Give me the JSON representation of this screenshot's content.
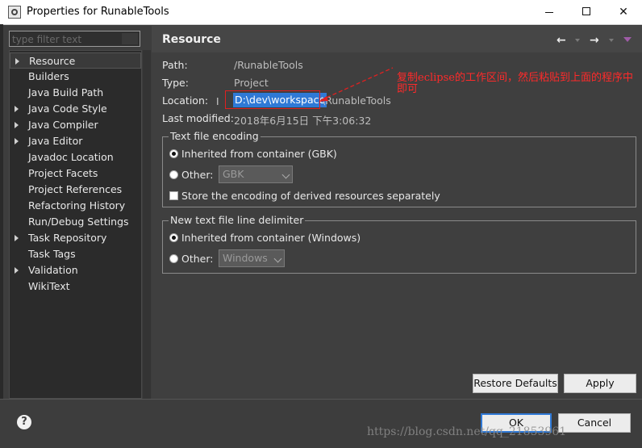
{
  "window": {
    "title": "Properties for RunableTools"
  },
  "filter": {
    "placeholder": "type filter text"
  },
  "tree": {
    "items": [
      {
        "label": "Resource",
        "expandable": true,
        "selected": true
      },
      {
        "label": "Builders",
        "expandable": false
      },
      {
        "label": "Java Build Path",
        "expandable": false
      },
      {
        "label": "Java Code Style",
        "expandable": true
      },
      {
        "label": "Java Compiler",
        "expandable": true
      },
      {
        "label": "Java Editor",
        "expandable": true
      },
      {
        "label": "Javadoc Location",
        "expandable": false
      },
      {
        "label": "Project Facets",
        "expandable": false
      },
      {
        "label": "Project References",
        "expandable": false
      },
      {
        "label": "Refactoring History",
        "expandable": false
      },
      {
        "label": "Run/Debug Settings",
        "expandable": false
      },
      {
        "label": "Task Repository",
        "expandable": true
      },
      {
        "label": "Task Tags",
        "expandable": false
      },
      {
        "label": "Validation",
        "expandable": true
      },
      {
        "label": "WikiText",
        "expandable": false
      }
    ]
  },
  "page": {
    "title": "Resource",
    "path_label": "Path:",
    "path_value": "/RunableTools",
    "type_label": "Type:",
    "type_value": "Project",
    "location_label": "Location:",
    "location_selected": "D:\\dev\\workspace",
    "location_rest": "\\RunableTools",
    "modified_label": "Last modified:",
    "modified_value": "2018年6月15日 下午3:06:32"
  },
  "annotation": {
    "text": "复制eclipse的工作区间，然后粘贴到上面的程序中即可"
  },
  "encoding": {
    "group_title": "Text file encoding",
    "inherited_label": "Inherited from container (GBK)",
    "other_label": "Other:",
    "other_value": "GBK",
    "store_label": "Store the encoding of derived resources separately"
  },
  "delimiter": {
    "group_title": "New text file line delimiter",
    "inherited_label": "Inherited from container (Windows)",
    "other_label": "Other:",
    "other_value": "Windows"
  },
  "buttons": {
    "restore": "Restore Defaults",
    "apply": "Apply",
    "ok": "OK",
    "cancel": "Cancel",
    "help": "?"
  },
  "watermark": {
    "text": "https://blog.csdn.net/qq_21853961"
  },
  "colors": {
    "selection": "#2f79d6",
    "annotation": "#ff2a2a",
    "background": "#3f3f3f"
  },
  "icons": {
    "app": "eclipse-properties-icon",
    "back": "arrow-left-icon",
    "forward": "arrow-right-icon",
    "menu": "view-menu-icon",
    "help": "help-icon"
  }
}
